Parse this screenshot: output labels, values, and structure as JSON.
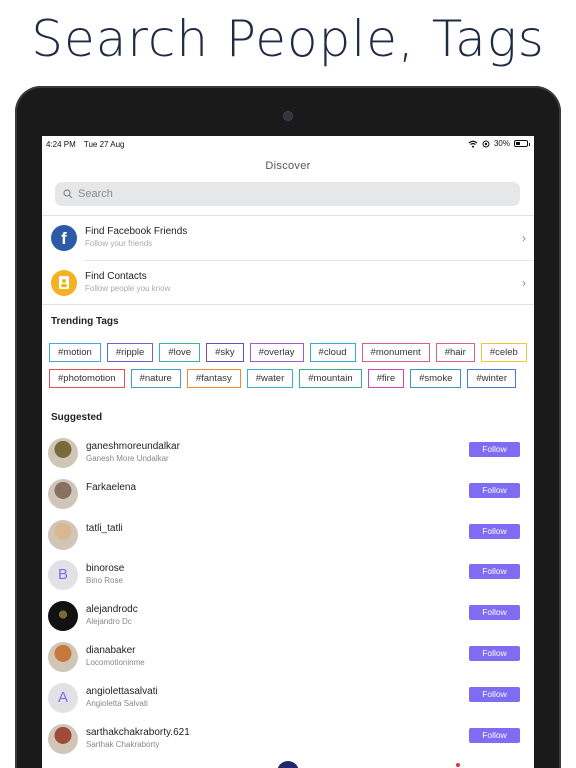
{
  "headline": "Search People, Tags",
  "status": {
    "time": "4:24 PM",
    "date": "Tue 27 Aug",
    "battery": "30%"
  },
  "nav": {
    "title": "Discover"
  },
  "search": {
    "placeholder": "Search"
  },
  "menu": [
    {
      "title": "Find Facebook Friends",
      "subtitle": "Follow your friends",
      "icon": "facebook-icon",
      "icon_glyph": "f",
      "color": "#2f5aa7"
    },
    {
      "title": "Find Contacts",
      "subtitle": "Follow people you know",
      "icon": "contacts-icon",
      "color": "#f4b223"
    }
  ],
  "trending": {
    "title": "Trending Tags",
    "row1": [
      {
        "label": "#motion",
        "color": "#4aa5e0"
      },
      {
        "label": "#ripple",
        "color": "#6b63d8"
      },
      {
        "label": "#love",
        "color": "#3fb2a8"
      },
      {
        "label": "#sky",
        "color": "#5a52c8"
      },
      {
        "label": "#overlay",
        "color": "#a35ad6"
      },
      {
        "label": "#cloud",
        "color": "#3aa8d8"
      },
      {
        "label": "#monument",
        "color": "#e35a8a"
      },
      {
        "label": "#hair",
        "color": "#e0607a"
      },
      {
        "label": "#celeb",
        "color": "#f2c63a"
      }
    ],
    "row2": [
      {
        "label": "#photomotion",
        "color": "#e0505a"
      },
      {
        "label": "#nature",
        "color": "#3fa0c8"
      },
      {
        "label": "#fantasy",
        "color": "#f08a3a"
      },
      {
        "label": "#water",
        "color": "#3ab0d6"
      },
      {
        "label": "#mountain",
        "color": "#3aaa90"
      },
      {
        "label": "#fire",
        "color": "#cc4ab0"
      },
      {
        "label": "#smoke",
        "color": "#3a98c8"
      },
      {
        "label": "#winter",
        "color": "#4a78d8"
      }
    ]
  },
  "suggested": {
    "title": "Suggested",
    "follow_label": "Follow",
    "users": [
      {
        "username": "ganeshmoreundalkar",
        "name": "Ganesh More Undalkar",
        "avatar": "photo",
        "avatar_color": "#7a6a3a"
      },
      {
        "username": "Farkaelena",
        "name": "",
        "avatar": "photo",
        "avatar_color": "#8a7060"
      },
      {
        "username": "tatli_tatli",
        "name": "",
        "avatar": "photo",
        "avatar_color": "#d8b890"
      },
      {
        "username": "binorose",
        "name": "Bino Rose",
        "avatar": "letter",
        "letter": "B"
      },
      {
        "username": "alejandrodc",
        "name": "Alejandro Dc",
        "avatar": "photo",
        "avatar_color": "#111111"
      },
      {
        "username": "dianabaker",
        "name": "Locomotioninme",
        "avatar": "photo",
        "avatar_color": "#c8783a"
      },
      {
        "username": "angiolettasalvati",
        "name": "Angioletta Salvati",
        "avatar": "letter",
        "letter": "A"
      },
      {
        "username": "sarthakchakraborty.621",
        "name": "Sarthak Chakraborty",
        "avatar": "photo",
        "avatar_color": "#a04a3a"
      }
    ]
  },
  "colors": {
    "accent": "#7e6cf2"
  }
}
